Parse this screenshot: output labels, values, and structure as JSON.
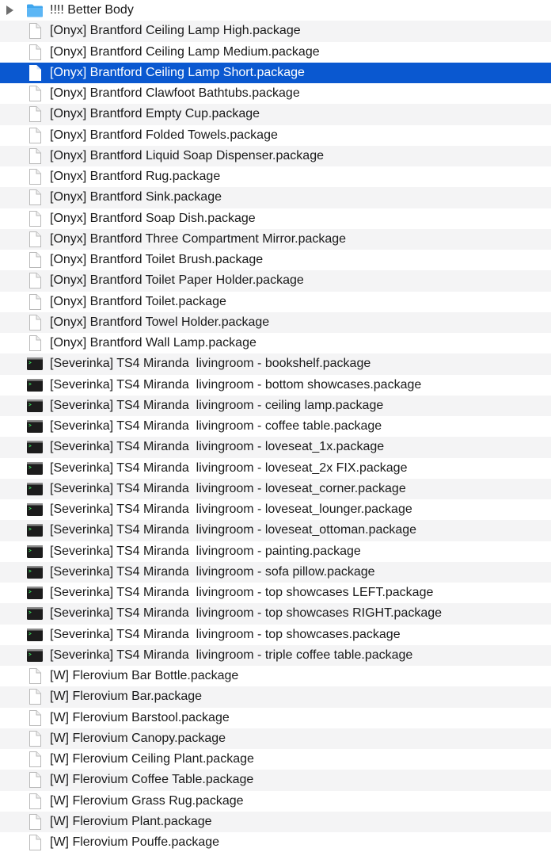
{
  "window": {
    "view": "Finder list view",
    "selected_index": 3
  },
  "colors": {
    "selection": "#0a58d0",
    "alt_row": "#f4f4f5",
    "folder": "#5cb6f5",
    "terminal_icon": "#1c1c1c"
  },
  "rows": [
    {
      "label": "!!!! Better Body",
      "icon": "folder-icon"
    },
    {
      "label": "[Onyx] Brantford Ceiling Lamp High.package",
      "icon": "document-icon"
    },
    {
      "label": "[Onyx] Brantford Ceiling Lamp Medium.package",
      "icon": "document-icon"
    },
    {
      "label": "[Onyx] Brantford Ceiling Lamp Short.package",
      "icon": "document-icon"
    },
    {
      "label": "[Onyx] Brantford Clawfoot Bathtubs.package",
      "icon": "document-icon"
    },
    {
      "label": "[Onyx] Brantford Empty Cup.package",
      "icon": "document-icon"
    },
    {
      "label": "[Onyx] Brantford Folded Towels.package",
      "icon": "document-icon"
    },
    {
      "label": "[Onyx] Brantford Liquid Soap Dispenser.package",
      "icon": "document-icon"
    },
    {
      "label": "[Onyx] Brantford Rug.package",
      "icon": "document-icon"
    },
    {
      "label": "[Onyx] Brantford Sink.package",
      "icon": "document-icon"
    },
    {
      "label": "[Onyx] Brantford Soap Dish.package",
      "icon": "document-icon"
    },
    {
      "label": "[Onyx] Brantford Three Compartment Mirror.package",
      "icon": "document-icon"
    },
    {
      "label": "[Onyx] Brantford Toilet Brush.package",
      "icon": "document-icon"
    },
    {
      "label": "[Onyx] Brantford Toilet Paper Holder.package",
      "icon": "document-icon"
    },
    {
      "label": "[Onyx] Brantford Toilet.package",
      "icon": "document-icon"
    },
    {
      "label": "[Onyx] Brantford Towel Holder.package",
      "icon": "document-icon"
    },
    {
      "label": "[Onyx] Brantford Wall Lamp.package",
      "icon": "document-icon"
    },
    {
      "label": "[Severinka] TS4 Miranda  livingroom - bookshelf.package",
      "icon": "terminal-icon"
    },
    {
      "label": "[Severinka] TS4 Miranda  livingroom - bottom showcases.package",
      "icon": "terminal-icon"
    },
    {
      "label": "[Severinka] TS4 Miranda  livingroom - ceiling lamp.package",
      "icon": "terminal-icon"
    },
    {
      "label": "[Severinka] TS4 Miranda  livingroom - coffee table.package",
      "icon": "terminal-icon"
    },
    {
      "label": "[Severinka] TS4 Miranda  livingroom - loveseat_1x.package",
      "icon": "terminal-icon"
    },
    {
      "label": "[Severinka] TS4 Miranda  livingroom - loveseat_2x FIX.package",
      "icon": "terminal-icon"
    },
    {
      "label": "[Severinka] TS4 Miranda  livingroom - loveseat_corner.package",
      "icon": "terminal-icon"
    },
    {
      "label": "[Severinka] TS4 Miranda  livingroom - loveseat_lounger.package",
      "icon": "terminal-icon"
    },
    {
      "label": "[Severinka] TS4 Miranda  livingroom - loveseat_ottoman.package",
      "icon": "terminal-icon"
    },
    {
      "label": "[Severinka] TS4 Miranda  livingroom - painting.package",
      "icon": "terminal-icon"
    },
    {
      "label": "[Severinka] TS4 Miranda  livingroom - sofa pillow.package",
      "icon": "terminal-icon"
    },
    {
      "label": "[Severinka] TS4 Miranda  livingroom - top showcases LEFT.package",
      "icon": "terminal-icon"
    },
    {
      "label": "[Severinka] TS4 Miranda  livingroom - top showcases RIGHT.package",
      "icon": "terminal-icon"
    },
    {
      "label": "[Severinka] TS4 Miranda  livingroom - top showcases.package",
      "icon": "terminal-icon"
    },
    {
      "label": "[Severinka] TS4 Miranda  livingroom - triple coffee table.package",
      "icon": "terminal-icon"
    },
    {
      "label": "[W] Flerovium Bar Bottle.package",
      "icon": "document-icon"
    },
    {
      "label": "[W] Flerovium Bar.package",
      "icon": "document-icon"
    },
    {
      "label": "[W] Flerovium Barstool.package",
      "icon": "document-icon"
    },
    {
      "label": "[W] Flerovium Canopy.package",
      "icon": "document-icon"
    },
    {
      "label": "[W] Flerovium Ceiling Plant.package",
      "icon": "document-icon"
    },
    {
      "label": "[W] Flerovium Coffee Table.package",
      "icon": "document-icon"
    },
    {
      "label": "[W] Flerovium Grass Rug.package",
      "icon": "document-icon"
    },
    {
      "label": "[W] Flerovium Plant.package",
      "icon": "document-icon"
    },
    {
      "label": "[W] Flerovium Pouffe.package",
      "icon": "document-icon"
    }
  ]
}
